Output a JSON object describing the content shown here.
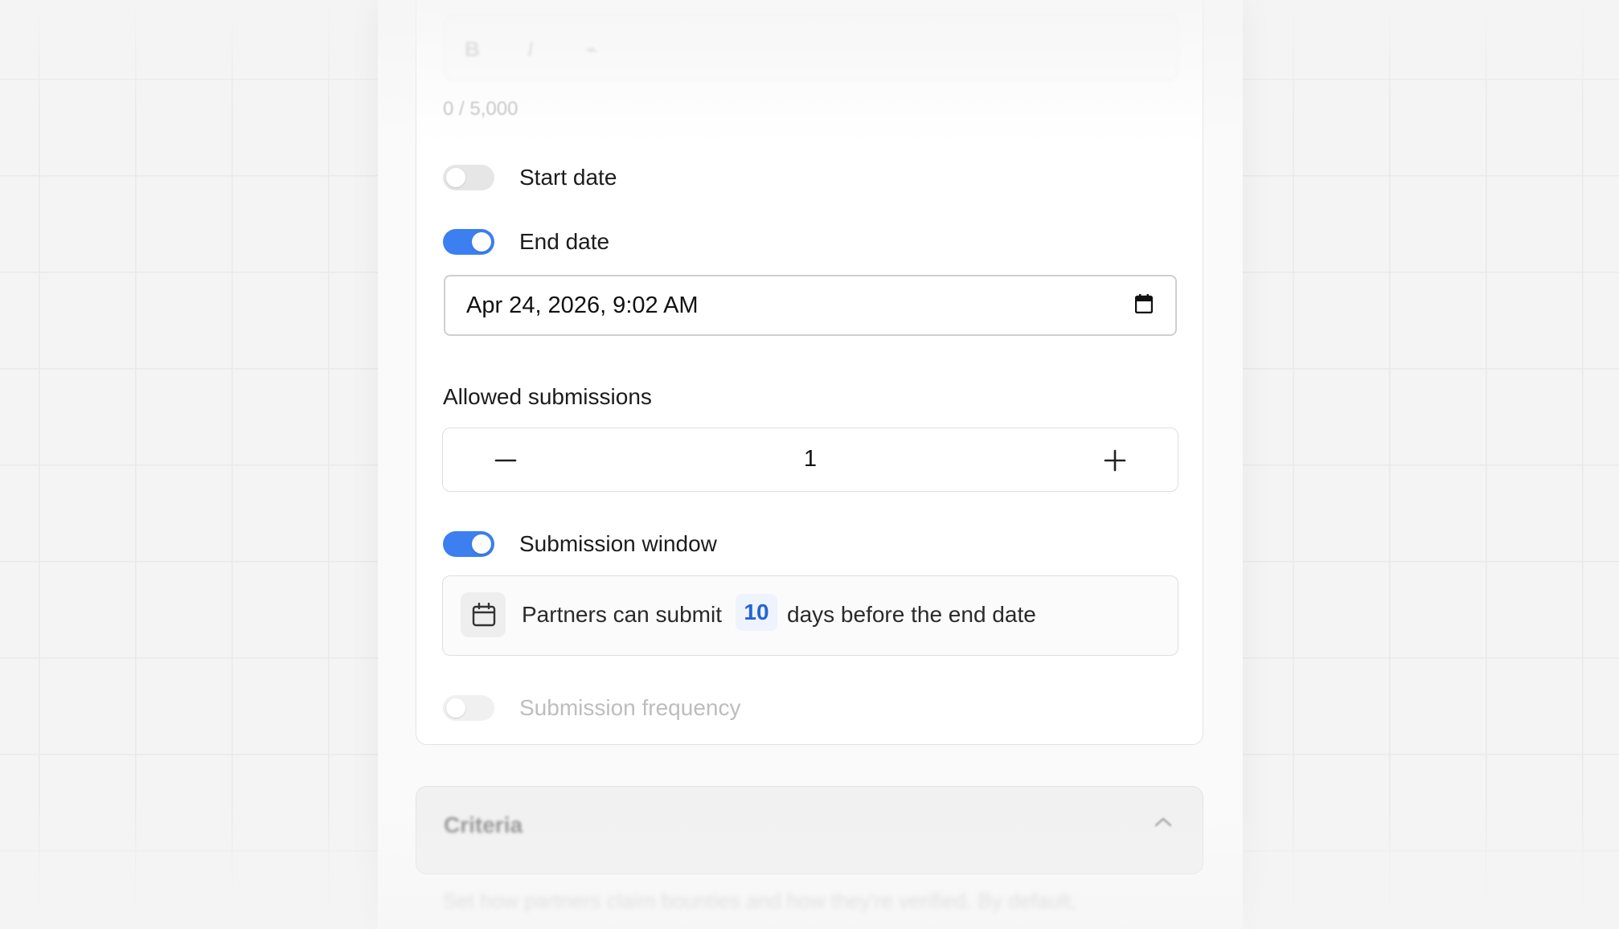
{
  "description_editor": {
    "toolbar": [
      {
        "icon": "bold-icon",
        "glyph": "B"
      },
      {
        "icon": "italic-icon",
        "glyph": "I"
      },
      {
        "icon": "link-icon",
        "glyph": "⌁"
      }
    ],
    "char_count": "0 / 5,000"
  },
  "settings": {
    "start_date": {
      "label": "Start date",
      "enabled": false
    },
    "end_date": {
      "label": "End date",
      "enabled": true,
      "value": "Apr 24, 2026, 9:02 AM"
    },
    "allowed_submissions": {
      "label": "Allowed submissions",
      "value": "1"
    },
    "submission_window": {
      "label": "Submission window",
      "enabled": true,
      "text_before": "Partners can submit",
      "days": "10",
      "text_after": "days before the end date"
    },
    "submission_frequency": {
      "label": "Submission frequency",
      "enabled": false
    }
  },
  "criteria": {
    "title": "Criteria",
    "description": "Set how partners claim bounties and how they're verified. By default,"
  },
  "colors": {
    "accent": "#3b7ff0",
    "chip_text": "#2463d6"
  }
}
